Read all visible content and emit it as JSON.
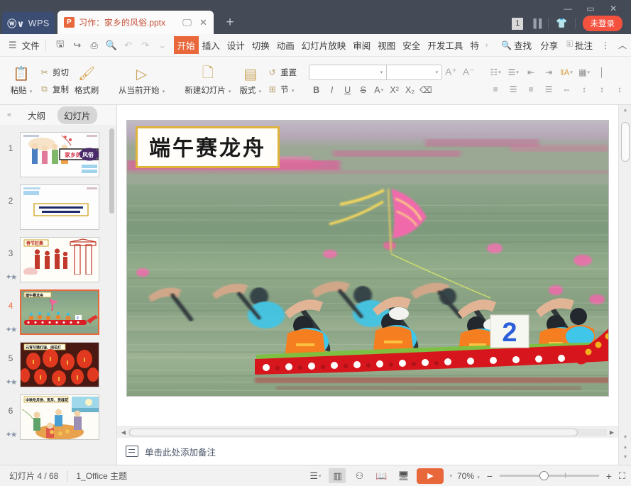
{
  "titlebar": {
    "app_name": "WPS",
    "app_mark": "W",
    "tab": {
      "title": "习作：家乡的风俗.pptx",
      "file_icon": "pptx-icon",
      "icon_letter": "P"
    },
    "tab_monitor_icon": "monitor-icon",
    "tab_close_icon": "✕",
    "new_tab_icon": "+",
    "badge_count": "1",
    "shirt_icon": "skin-theme-icon",
    "login_label": "未登录",
    "minimize": "—",
    "maximize": "▭",
    "close": "✕"
  },
  "menubar": {
    "hamburger_icon": "hamburger-icon",
    "file_label": "文件",
    "quick_icons": [
      "save-icon",
      "save-as-icon",
      "print-icon",
      "print-preview-icon",
      "undo-icon",
      "redo-icon",
      "customize-icon"
    ],
    "tabs": [
      {
        "label": "开始",
        "active": true
      },
      {
        "label": "插入",
        "active": false
      },
      {
        "label": "设计",
        "active": false
      },
      {
        "label": "切换",
        "active": false
      },
      {
        "label": "动画",
        "active": false
      },
      {
        "label": "幻灯片放映",
        "active": false
      },
      {
        "label": "审阅",
        "active": false
      },
      {
        "label": "视图",
        "active": false
      },
      {
        "label": "安全",
        "active": false
      },
      {
        "label": "开发工具",
        "active": false
      },
      {
        "label": "特",
        "active": false
      }
    ],
    "tab_overflow_icon": "›",
    "search_label": "查找",
    "search_icon": "search-icon",
    "share_label": "分享",
    "comment_label": "批注",
    "comment_icon": "comment-icon",
    "more_icon": "⋮",
    "collapse_ribbon_icon": "︿"
  },
  "ribbon": {
    "paste": {
      "label": "粘贴",
      "icon": "clipboard-icon",
      "has_dropdown": true
    },
    "cut": {
      "label": "剪切",
      "icon": "scissors-icon"
    },
    "copy": {
      "label": "复制",
      "icon": "copy-icon"
    },
    "format_painter": {
      "label": "格式刷",
      "icon": "format-painter-icon"
    },
    "start_from_current": {
      "label": "从当前开始",
      "icon": "play-circle-icon",
      "has_dropdown": true
    },
    "new_slide": {
      "label": "新建幻灯片",
      "icon": "new-slide-icon",
      "has_dropdown": true
    },
    "layout": {
      "label": "版式",
      "icon": "layout-icon",
      "has_dropdown": true
    },
    "reset": {
      "label": "重置",
      "icon": "reset-icon"
    },
    "section": {
      "label": "节",
      "icon": "section-icon",
      "has_dropdown": true
    },
    "font_name_value": "",
    "font_size_value": "",
    "grow_font": "A⁺",
    "shrink_font": "A⁻",
    "bold": "B",
    "italic": "I",
    "underline": "U",
    "strikethrough": "S",
    "font_color": "A",
    "superscript": "X²",
    "subscript": "X₂",
    "clear_format": "clear-format-icon",
    "paragraph_icons": [
      "bullets-icon",
      "numbering-icon",
      "decrease-indent-icon",
      "increase-indent-icon",
      "text-direction-icon",
      "align-text-icon"
    ],
    "align_icons": [
      "align-left-icon",
      "align-center-icon",
      "align-right-icon",
      "align-justify-icon",
      "distribute-icon",
      "line-spacing-icon",
      "paragraph-spacing-icon",
      "columns-icon"
    ]
  },
  "sidebar": {
    "collapse_icon": "«",
    "tabs": [
      {
        "label": "大纲",
        "active": false
      },
      {
        "label": "幻灯片",
        "active": true
      }
    ],
    "slides": [
      {
        "number": "1",
        "selected": false,
        "starred": false,
        "title": "家乡的 风俗"
      },
      {
        "number": "2",
        "selected": false,
        "starred": false,
        "title": "说一说，这是哪个节日？照灯了什么风俗？"
      },
      {
        "number": "3",
        "selected": false,
        "starred": true,
        "title": "春节赶集"
      },
      {
        "number": "4",
        "selected": true,
        "starred": true,
        "title": "端午赛龙舟"
      },
      {
        "number": "5",
        "selected": false,
        "starred": true,
        "title": "元宵节猜灯谜、闹花灯"
      },
      {
        "number": "6",
        "selected": false,
        "starred": true,
        "title": "中秋吃月饼、赏月、赏桂花"
      }
    ]
  },
  "slide": {
    "title": "端午赛龙舟",
    "boat_number": "2",
    "scene": "dragon-boat-race-photo"
  },
  "notes": {
    "placeholder": "单击此处添加备注",
    "icon": "notes-icon"
  },
  "statusbar": {
    "slide_counter": "幻灯片 4 / 68",
    "theme_name": "1_Office 主题",
    "view_modes": [
      {
        "name": "outline-view-icon",
        "glyph": "≡",
        "active": false
      },
      {
        "name": "normal-view-icon",
        "glyph": "normal",
        "active": true
      },
      {
        "name": "slide-sorter-icon",
        "glyph": "grid",
        "active": false
      },
      {
        "name": "reading-view-icon",
        "glyph": "book",
        "active": false
      },
      {
        "name": "presenter-view-icon",
        "glyph": "screen",
        "active": false
      }
    ],
    "play_label": "▶",
    "zoom_level": "70%",
    "zoom_out": "−",
    "zoom_in": "+",
    "fit_icon": "fit-window-icon"
  },
  "scrollbars": {
    "h_left_arrow": "◀",
    "h_right_arrow": "▶",
    "v_up_arrow": "▲",
    "v_down_arrow": "▼"
  },
  "colors": {
    "accent_orange": "#e8683b",
    "titlebar_bg": "#444a56",
    "login_red": "#f4513f",
    "gold_border": "#e0b33a"
  }
}
